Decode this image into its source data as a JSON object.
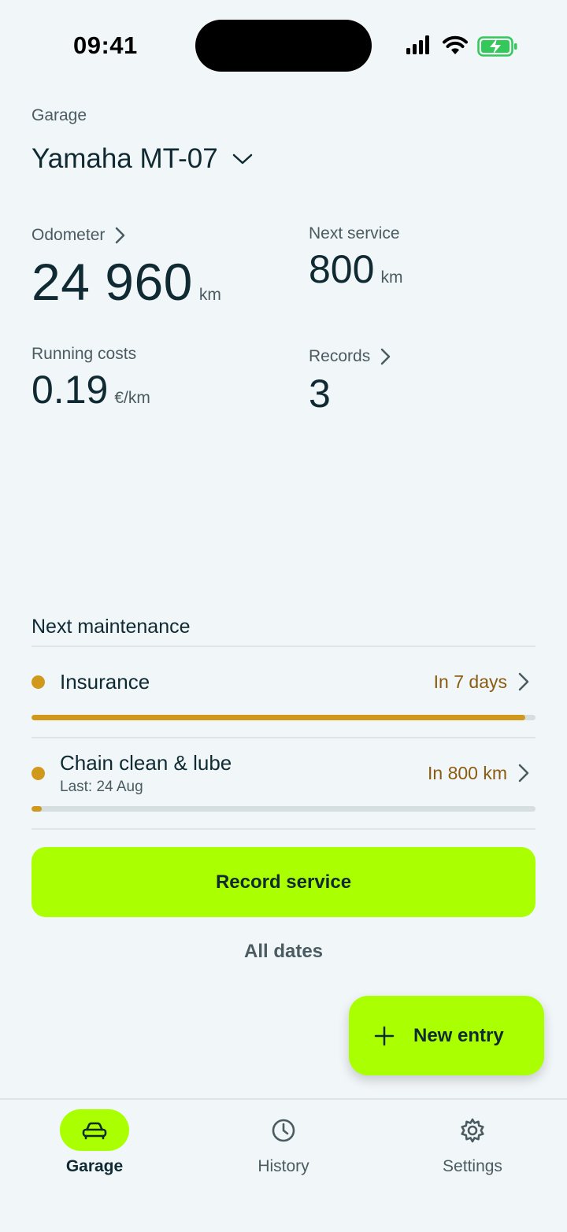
{
  "status_bar": {
    "time": "09:41"
  },
  "header": {
    "garage_label": "Garage",
    "vehicle_name": "Yamaha MT-07"
  },
  "stats": {
    "odometer": {
      "label": "Odometer",
      "value": "24 960",
      "unit": "km"
    },
    "next_service": {
      "label": "Next service",
      "value": "800",
      "unit": "km"
    },
    "running_costs": {
      "label": "Running costs",
      "value": "0.19",
      "unit": "€/km"
    },
    "records": {
      "label": "Records",
      "value": "3"
    }
  },
  "maintenance": {
    "title": "Next maintenance",
    "items": [
      {
        "title": "Insurance",
        "subtitle": "",
        "due": "In 7 days",
        "progress": 0.98
      },
      {
        "title": "Chain clean & lube",
        "subtitle": "Last: 24 Aug",
        "due": "In 800 km",
        "progress": 0.02
      }
    ]
  },
  "actions": {
    "record_service": "Record service",
    "all_dates": "All dates",
    "new_entry": "New entry"
  },
  "nav": {
    "items": [
      {
        "label": "Garage",
        "icon": "car-icon",
        "active": true
      },
      {
        "label": "History",
        "icon": "clock-icon",
        "active": false
      },
      {
        "label": "Settings",
        "icon": "gear-icon",
        "active": false
      }
    ]
  },
  "colors": {
    "accent": "#aaff00",
    "warning": "#d1991b",
    "due_text": "#8a5b10",
    "background": "#f1f6f8"
  }
}
